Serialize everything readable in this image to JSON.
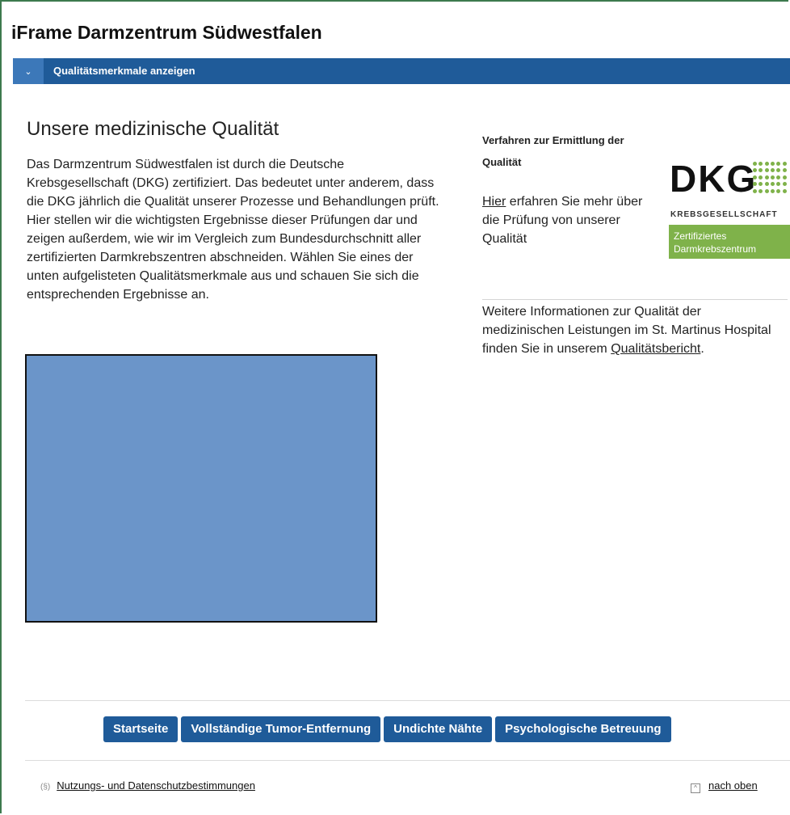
{
  "header": {
    "title": "iFrame Darmzentrum Südwestfalen"
  },
  "topbar": {
    "toggle_icon": "chevron-down-icon",
    "toggle_glyph": "⌄",
    "label": "Qualitätsmerkmale anzeigen"
  },
  "main": {
    "heading": "Unsere medizinische Qualität",
    "intro": "Das Darmzentrum Südwestfalen ist durch die Deutsche Krebsgesellschaft (DKG) zertifiziert. Das bedeutet unter anderem, dass die DKG jährlich die Qualität unserer Prozesse und Behandlungen prüft. Hier stellen wir die wichtigsten Ergebnisse dieser Prüfungen dar und zeigen außerdem, wie wir im Vergleich zum Bundesdurchschnitt aller zertifizierten Darmkrebszentren abschneiden. Wählen Sie eines der unten aufgelisteten Qualitätsmerkmale aus und schauen Sie sich die entsprechenden Ergebnisse an."
  },
  "sidebar": {
    "heading": "Verfahren zur Ermittlung der Qualität",
    "link_text": "Hier",
    "text_after_link": " erfahren Sie mehr über die Prüfung von unserer Qualität",
    "logo": {
      "letters": "DKG",
      "subtitle": "KREBSGESELLSCHAFT",
      "badge_line1": "Zertifiziertes",
      "badge_line2": "Darmkrebszentrum"
    },
    "more_text": "Weitere Informationen zur Qualität der medizinischen Leistungen im St. Martinus Hospital finden Sie in unserem ",
    "more_link": "Qualitätsbericht",
    "more_end": "."
  },
  "nav": {
    "buttons": [
      "Startseite",
      "Vollständige Tumor-Entfernung",
      "Undichte Nähte",
      "Psychologische Betreuung"
    ]
  },
  "footer": {
    "left_icon": "section-icon",
    "left_glyph": "(§)",
    "left_link": "Nutzungs- und Datenschutzbestimmungen",
    "right_icon": "arrow-up-icon",
    "right_glyph": "^",
    "right_link": "nach oben"
  },
  "colors": {
    "brand_blue": "#1f5b99",
    "toggle_blue": "#3c78b9",
    "placeholder_blue": "#6b95c9",
    "dkg_green": "#7fb24a"
  }
}
